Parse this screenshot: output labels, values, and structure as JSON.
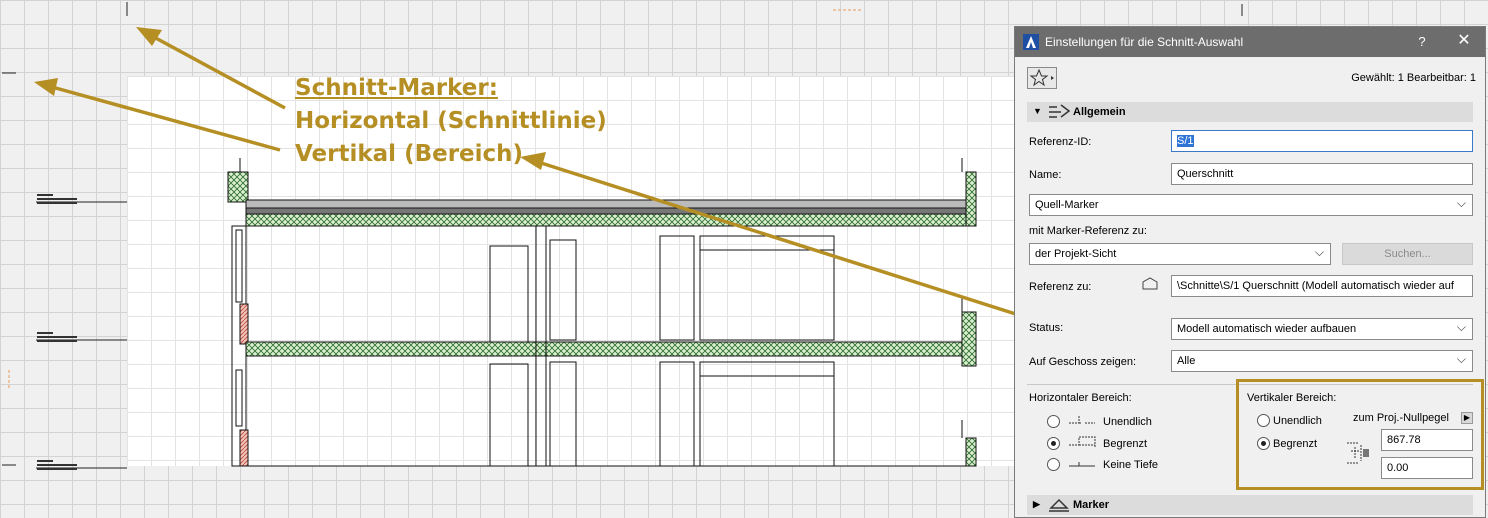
{
  "annotation": {
    "title": "Schnitt-Marker:",
    "line1": "Horizontal (Schnittlinie)",
    "line2": "Vertikal (Bereich)",
    "color": "#b58f24"
  },
  "dialog": {
    "title": "Einstellungen für die Schnitt-Auswahl",
    "help_label": "?",
    "close_label": "✕",
    "selection_info": "Gewählt: 1 Bearbeitbar: 1",
    "sections": {
      "general": {
        "title": "Allgemein",
        "icon": "section-settings-icon"
      },
      "marker": {
        "title": "Marker",
        "icon": "marker-icon"
      }
    },
    "ref_id": {
      "label": "Referenz-ID:",
      "value": "S/1"
    },
    "name": {
      "label": "Name:",
      "value": "Querschnitt"
    },
    "source_marker": {
      "value": "Quell-Marker"
    },
    "marker_ref_to": {
      "label": "mit Marker-Referenz zu:",
      "value": "der Projekt-Sicht"
    },
    "search_button": "Suchen...",
    "reference_to": {
      "label": "Referenz zu:",
      "value": "\\Schnitte\\S/1 Querschnitt (Modell automatisch wieder auf"
    },
    "status": {
      "label": "Status:",
      "value": "Modell automatisch wieder aufbauen"
    },
    "show_on_story": {
      "label": "Auf Geschoss zeigen:",
      "value": "Alle"
    },
    "horizontal_range": {
      "label": "Horizontaler Bereich:",
      "options": [
        "Unendlich",
        "Begrenzt",
        "Keine Tiefe"
      ],
      "selected": "Begrenzt"
    },
    "vertical_range": {
      "label": "Vertikaler Bereich:",
      "options": [
        "Unendlich",
        "Begrenzt"
      ],
      "selected": "Begrenzt",
      "reference_label": "zum Proj.-Nullpegel",
      "top_value": "867.78",
      "bottom_value": "0.00"
    }
  }
}
